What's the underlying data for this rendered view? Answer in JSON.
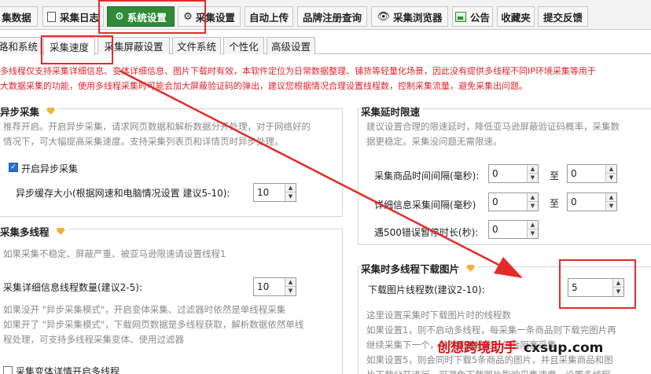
{
  "toolbar": [
    {
      "label": "集数据",
      "icon": "none"
    },
    {
      "label": "采集日志",
      "icon": "document-icon"
    },
    {
      "label": "系统设置",
      "icon": "gear-icon"
    },
    {
      "label": "采集设置",
      "icon": "gear-icon"
    },
    {
      "label": "自动上传",
      "icon": "none"
    },
    {
      "label": "品牌注册查询",
      "icon": "none"
    },
    {
      "label": "采集浏览器",
      "icon": "eye-icon"
    },
    {
      "label": "公告",
      "icon": "image-icon"
    },
    {
      "label": "收藏夹",
      "icon": "none"
    },
    {
      "label": "提交反馈",
      "icon": "none"
    }
  ],
  "tabs": [
    "路和系统",
    "采集速度",
    "采集屏蔽设置",
    "文件系统",
    "个性化",
    "高级设置"
  ],
  "notice": {
    "line1": "多线程仅支持采集详细信息、变体详细信息、图片下载时有效，本软件定位为日常数据整理、铺货等轻量化场景，因此没有提供多线程不同IP环境采集等用于",
    "line2": "大数据采集的功能，使用多线程采集时可能会加大屏蔽验证码的弹出，建议您根据情况合理设置线程数，控制采集流量，避免采集出问题。"
  },
  "async": {
    "title": "异步采集",
    "desc1": "推荐开启。开启异步采集，请求网页数据和解析数据分开处理，对于网络好的",
    "desc2": "情况下，可大幅提高采集速度。支持采集列表页和详情页时异步处理。",
    "checkbox": "开启异步采集",
    "cache_label": "异步缓存大小(根据网速和电脑情况设置 建议5-10):",
    "cache_value": "10"
  },
  "delay": {
    "title": "采集延时限速",
    "desc1": "建议设置合理的限速延时，降低亚马逊屏蔽验证码概率，采集数",
    "desc2": "据更稳定。采集没问题无需限速。",
    "row1_label": "采集商品时间间隔(毫秒):",
    "row1_from": "0",
    "row1_to": "0",
    "row2_label": "详细信息采集间隔(毫秒)",
    "row2_from": "0",
    "row2_to": "0",
    "row3_label": "遇500错误暂停时长(秒):",
    "row3_value": "0",
    "to_word": "至"
  },
  "multi": {
    "title": "采集多线程",
    "desc": "如果采集不稳定、屏蔽严重、被亚马逊限速请设置线程1",
    "threads_label": "采集详细信息线程数量(建议2-5):",
    "threads_value": "10",
    "note1": "如果没开 \"异步采集模式\"，开启变体采集、过滤器时依然是单线程采集",
    "note2": "如果开了 \"异步采集模式\"，下载网页数据是多线程获取，解析数据依然单线",
    "note3": "程处理，可支持多线程采集变体、使用过滤器",
    "variant_checkbox": "采集变体详情开启多线程"
  },
  "image": {
    "title": "采集时多线程下载图片",
    "label": "下载图片线程数(建议2-10):",
    "value": "5",
    "note1": "这里设置采集时下载图片时的线程数",
    "note2": "如果设置1，则不启动多线程，每采集一条商品则下载完图片再",
    "note3": "继续采集下一个，虽然速度稳定，但会阻塞采集",
    "note4": "如果设置5，则会同时下载5条商品的图片，并且采集商品和图",
    "note5": "片下载分开进行，可避免下载图片影响采集速度，设置多线程"
  },
  "watermark": {
    "text1": "创想跨境助手",
    "text2": "cxsup.com"
  },
  "colors": {
    "accent_green": "#2f8a3a",
    "annotation_red": "#e32b2b",
    "notice_red": "#e0242e"
  }
}
